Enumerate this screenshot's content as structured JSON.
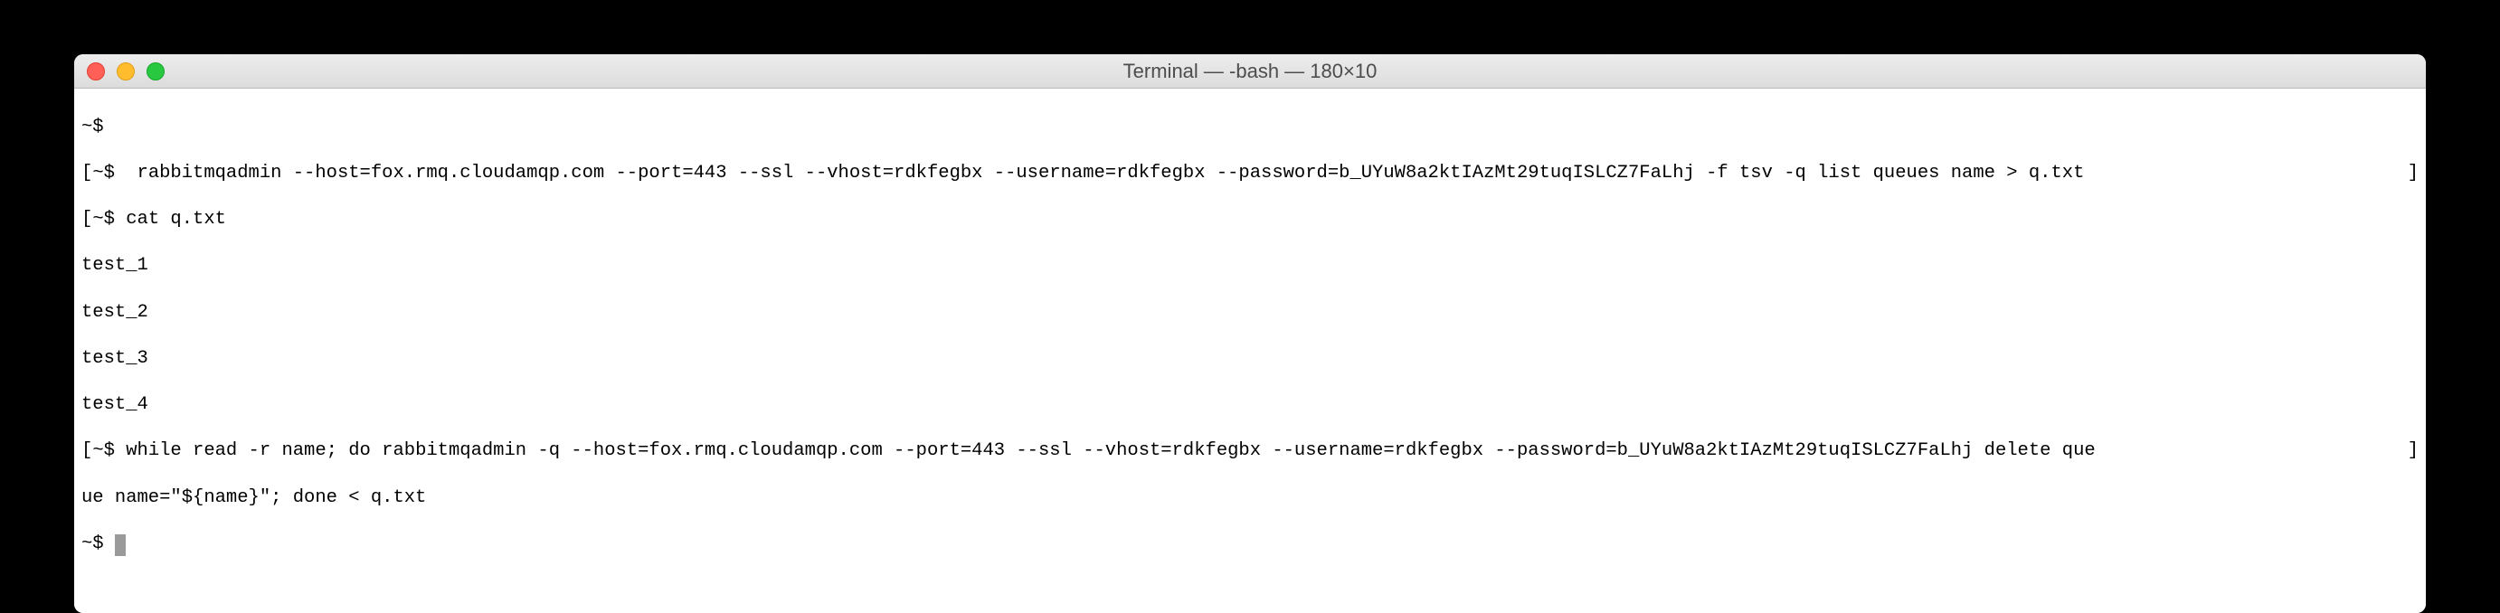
{
  "window": {
    "title": "Terminal — -bash — 180×10"
  },
  "terminal": {
    "prompt": "~$",
    "lines": {
      "line1_prompt": "~$ ",
      "line1_cmd": "",
      "line2_prompt": "~$ ",
      "line2_cmd": " rabbitmqadmin --host=fox.rmq.cloudamqp.com --port=443 --ssl --vhost=rdkfegbx --username=rdkfegbx --password=b_UYuW8a2ktIAzMt29tuqISLCZ7FaLhj -f tsv -q list queues name > q.txt ",
      "line3_prompt": "~$ ",
      "line3_cmd": "cat q.txt",
      "line4": "test_1",
      "line5": "test_2",
      "line6": "test_3",
      "line7": "test_4",
      "line8_prompt": "~$ ",
      "line8_cmd": "while read -r name; do rabbitmqadmin -q --host=fox.rmq.cloudamqp.com --port=443 --ssl --vhost=rdkfegbx --username=rdkfegbx --password=b_UYuW8a2ktIAzMt29tuqISLCZ7FaLhj delete que",
      "line9": "ue name=\"${name}\"; done < q.txt",
      "line10_prompt": "~$ "
    }
  }
}
